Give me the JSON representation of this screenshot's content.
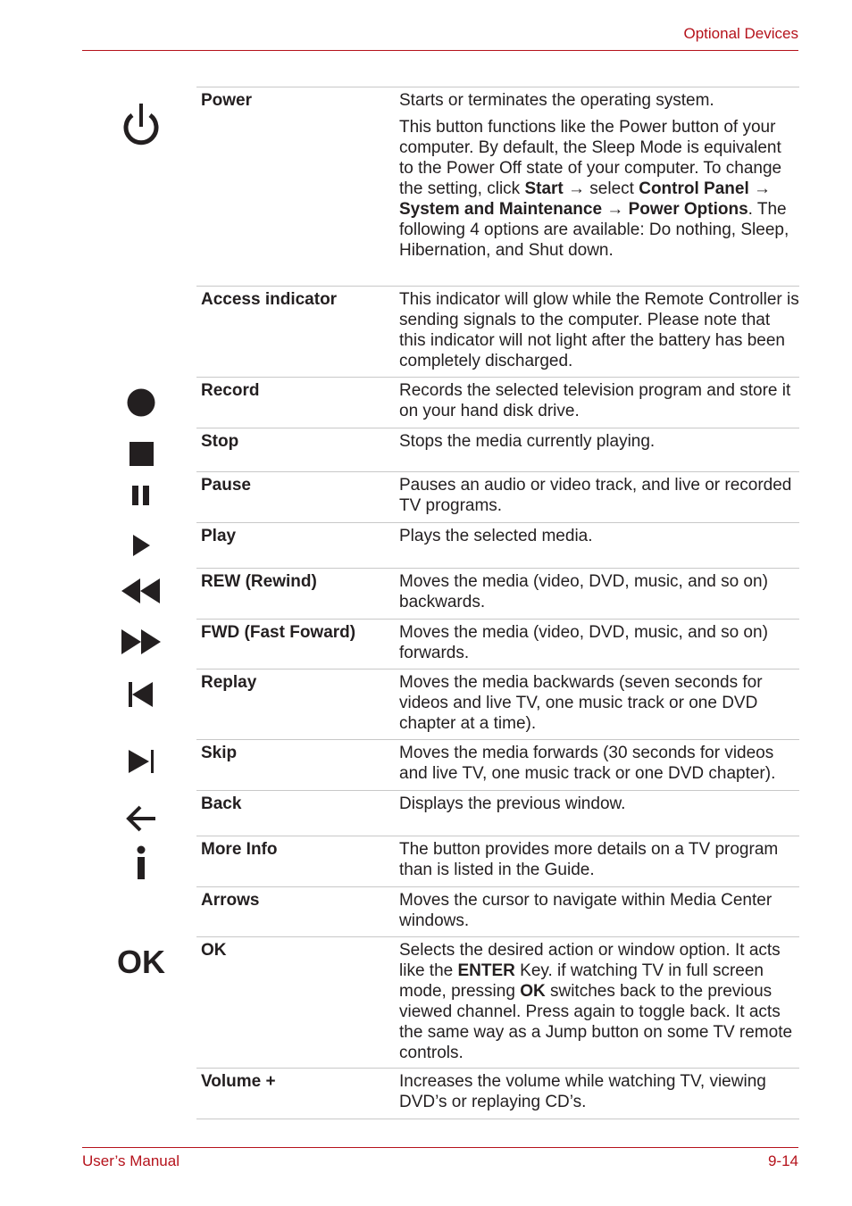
{
  "header": {
    "section_title": "Optional Devices"
  },
  "footer": {
    "left": "User’s Manual",
    "right": "9-14"
  },
  "rows": [
    {
      "icon": "power-icon",
      "term": "Power",
      "desc_parts": [
        "Starts or terminates the operating system.",
        "This button functions like the Power button of your computer. By default, the Sleep Mode is equivalent to the Power Off state of your computer. To change the setting, click ",
        "Start",
        " → select ",
        "Control Panel",
        " → ",
        "System and Maintenance",
        " → ",
        "Power Options",
        ". The following 4 options are available: Do nothing, Sleep, Hibernation, and Shut down."
      ]
    },
    {
      "icon": "",
      "term": "Access indicator",
      "desc": "This indicator will glow while the Remote Controller is sending signals to the computer. Please note that this indicator will not light after the battery has been completely discharged."
    },
    {
      "icon": "record-icon",
      "term": "Record",
      "desc": "Records the selected television program and store it on your hand disk drive."
    },
    {
      "icon": "stop-icon",
      "term": "Stop",
      "desc": "Stops the media currently playing."
    },
    {
      "icon": "pause-icon",
      "term": "Pause",
      "desc": "Pauses an audio or video track, and live or recorded TV programs."
    },
    {
      "icon": "play-icon",
      "term": "Play",
      "desc": "Plays the selected media."
    },
    {
      "icon": "rewind-icon",
      "term": "REW (Rewind)",
      "desc": "Moves the media (video, DVD, music, and so on) backwards."
    },
    {
      "icon": "fast-forward-icon",
      "term": "FWD (Fast Foward)",
      "desc": "Moves the media (video, DVD, music, and so on) forwards."
    },
    {
      "icon": "replay-icon",
      "term": "Replay",
      "desc": "Moves the media backwards (seven seconds for videos and live TV, one music track or one DVD chapter at a time)."
    },
    {
      "icon": "skip-icon",
      "term": "Skip",
      "desc": "Moves the media forwards (30 seconds for videos and live TV, one music track or one DVD chapter)."
    },
    {
      "icon": "back-arrow-icon",
      "term": "Back",
      "desc": "Displays the previous window."
    },
    {
      "icon": "info-icon",
      "term": "More Info",
      "desc": "The button provides more details on a TV program than is listed in the Guide."
    },
    {
      "icon": "",
      "term": "Arrows",
      "desc": "Moves the cursor to navigate within Media Center windows."
    },
    {
      "icon": "ok-icon",
      "icon_text": "OK",
      "term": "OK",
      "desc_parts": [
        "Selects the desired action or window option. It acts like the ",
        "ENTER",
        " Key. if watching TV in full screen mode, pressing ",
        "OK",
        " switches back to the previous viewed channel. Press again to toggle back. It acts the same way as a Jump button on some TV remote controls."
      ]
    },
    {
      "icon": "",
      "term": "Volume +",
      "desc": "Increases the volume while watching TV, viewing DVD’s or replaying CD’s."
    }
  ]
}
